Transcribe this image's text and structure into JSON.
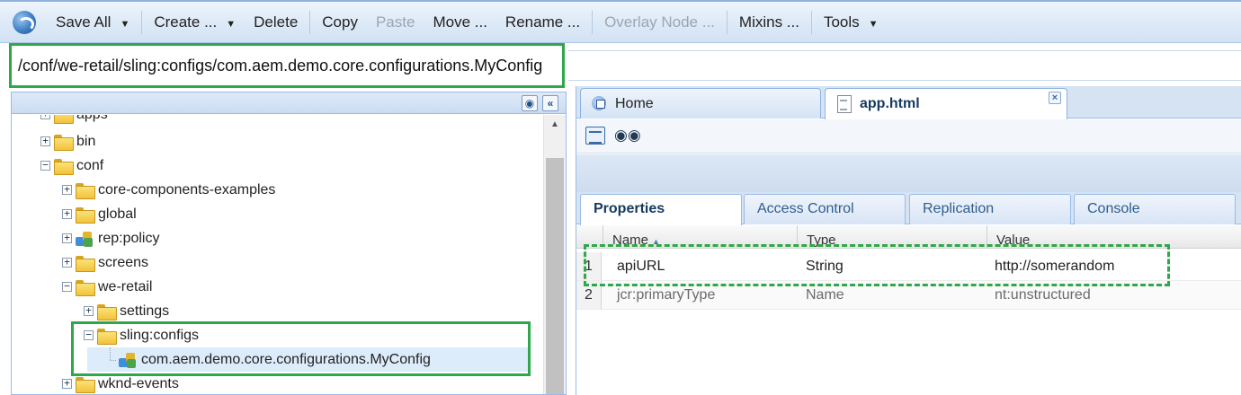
{
  "toolbar": {
    "save_all": "Save All",
    "create": "Create ...",
    "delete": "Delete",
    "copy": "Copy",
    "paste": "Paste",
    "move": "Move ...",
    "rename": "Rename ...",
    "overlay_node": "Overlay Node ...",
    "mixins": "Mixins ...",
    "tools": "Tools",
    "caret": "▼"
  },
  "path": {
    "value": "/conf/we-retail/sling:configs/com.aem.demo.core.configurations.MyConfig"
  },
  "tree": {
    "items": [
      {
        "label": "apps",
        "expander": "+"
      },
      {
        "label": "bin",
        "expander": "+"
      },
      {
        "label": "conf",
        "expander": "−"
      },
      {
        "label": "core-components-examples",
        "expander": "+"
      },
      {
        "label": "global",
        "expander": "+"
      },
      {
        "label": "rep:policy",
        "expander": "+"
      },
      {
        "label": "screens",
        "expander": "+"
      },
      {
        "label": "we-retail",
        "expander": "−"
      },
      {
        "label": "settings",
        "expander": "+"
      },
      {
        "label": "sling:configs",
        "expander": "−"
      },
      {
        "label": "com.aem.demo.core.configurations.MyConfig",
        "expander": ""
      },
      {
        "label": "wknd-events",
        "expander": "+"
      }
    ],
    "header_icons": [
      "binoculars-icon",
      "collapse-icon"
    ]
  },
  "editor_tabs": [
    {
      "label": "Home",
      "icon": "home-icon"
    },
    {
      "label": "app.html",
      "icon": "document-icon",
      "close": "×"
    }
  ],
  "property_tabs": [
    {
      "label": "Properties"
    },
    {
      "label": "Access Control"
    },
    {
      "label": "Replication"
    },
    {
      "label": "Console"
    }
  ],
  "grid": {
    "headers": [
      "Name",
      "Type",
      "Value"
    ],
    "sort_indicator": "▲",
    "rows": [
      {
        "num": "1",
        "name": "apiURL",
        "type": "String",
        "value": "http://somerandom"
      },
      {
        "num": "2",
        "name": "jcr:primaryType",
        "type": "Name",
        "value": "nt:unstructured"
      }
    ]
  },
  "colors": {
    "highlight_green": "#2ea84a",
    "panel_border": "#99bbe8",
    "selection": "#dcecfb"
  }
}
